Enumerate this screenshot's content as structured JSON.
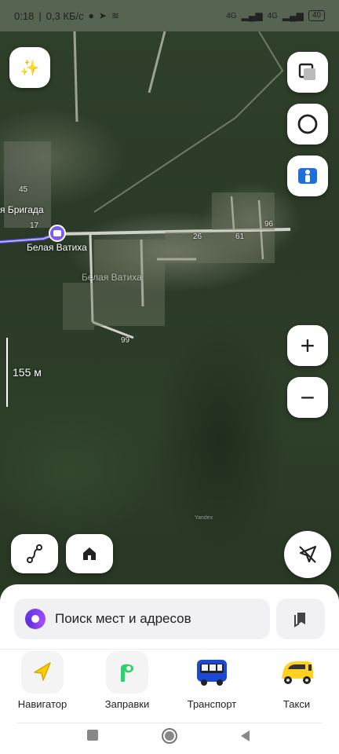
{
  "status_bar": {
    "time": "0:18",
    "speed": "0,3 КБ/с",
    "signal_left": "4G",
    "signal_right": "4G",
    "battery": "40"
  },
  "map": {
    "place_label": "Белая Ватиха",
    "place_label_faint": "Белая Ватиха",
    "street_label": "я Бригада",
    "house_numbers": [
      "45",
      "17",
      "26",
      "61",
      "96",
      "99"
    ],
    "scale_label": "155 м",
    "watermark": "Yandex"
  },
  "map_controls": {
    "zoom_in": "+",
    "zoom_out": "−"
  },
  "bottom_sheet": {
    "search_placeholder": "Поиск мест и адресов",
    "services": [
      {
        "label": "Навигатор",
        "icon": "navigator-arrow-icon"
      },
      {
        "label": "Заправки",
        "icon": "fuel-logo-icon"
      },
      {
        "label": "Транспорт",
        "icon": "bus-icon"
      },
      {
        "label": "Такси",
        "icon": "taxi-car-icon"
      }
    ]
  },
  "colors": {
    "route": "#5b4dff",
    "alice": "#7b3ff2",
    "fuel": "#2bd46b",
    "taxi": "#ffd21f"
  }
}
